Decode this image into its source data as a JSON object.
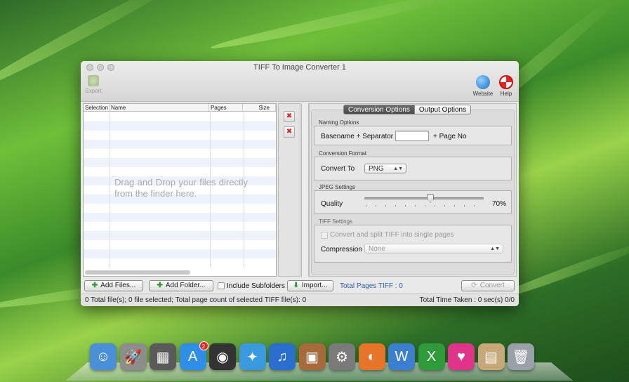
{
  "window": {
    "title": "TIFF To Image Converter 1"
  },
  "toolbar": {
    "export_label": "Export",
    "website_label": "Website",
    "help_label": "Help"
  },
  "file_table": {
    "columns": [
      "Selection",
      "Name",
      "Pages",
      "Size"
    ],
    "drop_hint": "Drag and Drop your files directly from the finder here."
  },
  "tabs": [
    {
      "label": "Conversion Options",
      "active": true
    },
    {
      "label": "Output Options",
      "active": false
    }
  ],
  "naming": {
    "group_title": "Naming Options",
    "basename_label": "Basename + Separator",
    "separator_value": "",
    "suffix_label": "+ Page No"
  },
  "format": {
    "group_title": "Conversion Format",
    "convert_to_label": "Convert To",
    "selected": "PNG"
  },
  "jpeg": {
    "group_title": "JPEG Settings",
    "quality_label": "Quality",
    "quality_value": 70,
    "quality_text": "70%"
  },
  "tiff": {
    "group_title": "TIFF Settings",
    "split_label": "Convert and split TIFF into single pages",
    "split_checked": false,
    "compression_label": "Compression",
    "compression_value": "None"
  },
  "actions": {
    "add_files": "Add Files...",
    "add_folder": "Add Folder...",
    "include_subfolders": "Include Subfolders",
    "import": "Import...",
    "total_pages": "Total Pages TIFF : 0",
    "convert": "Convert"
  },
  "status": {
    "left": "0 Total file(s); 0 file selected; Total page count of selected TIFF file(s): 0",
    "right": "Total Time Taken : 0 sec(s) 0/0"
  },
  "dock": {
    "items": [
      {
        "name": "finder-icon",
        "color": "#4a8fd8",
        "glyph": "☺"
      },
      {
        "name": "launchpad-icon",
        "color": "#8d8d8d",
        "glyph": "🚀"
      },
      {
        "name": "mission-control-icon",
        "color": "#5a5a5a",
        "glyph": "▦"
      },
      {
        "name": "app-store-icon",
        "color": "#2f8fe8",
        "glyph": "A",
        "badge": "2"
      },
      {
        "name": "dashboard-icon",
        "color": "#333",
        "glyph": "◉"
      },
      {
        "name": "safari-icon",
        "color": "#3a9ae0",
        "glyph": "✦"
      },
      {
        "name": "itunes-icon",
        "color": "#2a6fd0",
        "glyph": "♫"
      },
      {
        "name": "iphoto-icon",
        "color": "#a86a3a",
        "glyph": "▣"
      },
      {
        "name": "system-preferences-icon",
        "color": "#7a7a7a",
        "glyph": "⚙"
      },
      {
        "name": "firefox-icon",
        "color": "#e8742a",
        "glyph": "◐"
      },
      {
        "name": "word-icon",
        "color": "#3a7fd0",
        "glyph": "W"
      },
      {
        "name": "excel-icon",
        "color": "#2e9a3a",
        "glyph": "X"
      },
      {
        "name": "heart-app-icon",
        "color": "#e0348a",
        "glyph": "♥"
      },
      {
        "name": "photos-stack-icon",
        "color": "#c8a878",
        "glyph": "▤"
      },
      {
        "name": "trash-icon",
        "color": "#9aa0a8",
        "glyph": "🗑"
      }
    ]
  },
  "colors": {
    "accent_blue": "#2a5db0",
    "active_tab": "#555555",
    "remove_red": "#dd2222"
  }
}
